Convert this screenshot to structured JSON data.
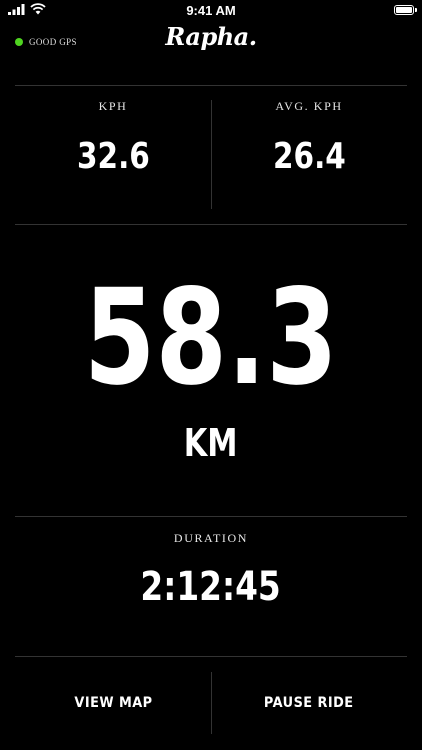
{
  "status_bar": {
    "time": "9:41 AM"
  },
  "header": {
    "gps_status": "GOOD GPS",
    "gps_color": "#4fd420",
    "logo": "Rapha."
  },
  "metrics": {
    "kph_label": "KPH",
    "kph_value": "32.6",
    "avg_kph_label": "AVG. KPH",
    "avg_kph_value": "26.4",
    "distance_value": "58.3",
    "distance_unit": "KM",
    "duration_label": "DURATION",
    "duration_value": "2:12:45"
  },
  "actions": {
    "view_map": "VIEW MAP",
    "pause_ride": "PAUSE RIDE"
  }
}
